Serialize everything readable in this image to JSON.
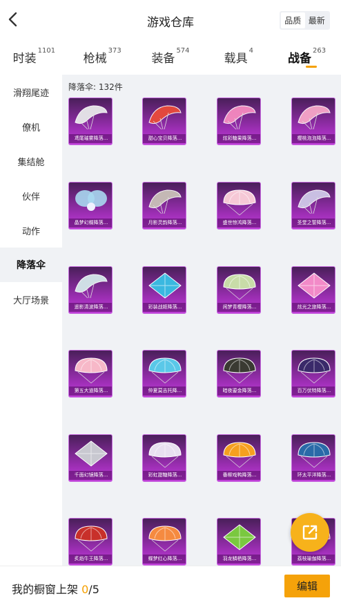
{
  "header": {
    "title": "游戏仓库",
    "sort_options": [
      "品质",
      "最新"
    ]
  },
  "tabs": [
    {
      "label": "时装",
      "count": "1101"
    },
    {
      "label": "枪械",
      "count": "373"
    },
    {
      "label": "装备",
      "count": "574"
    },
    {
      "label": "载具",
      "count": "4"
    },
    {
      "label": "战备",
      "count": "263"
    }
  ],
  "sidebar": {
    "items": [
      "滑翔尾迹",
      "僚机",
      "集结舱",
      "伙伴",
      "动作",
      "降落伞",
      "大厅场景"
    ]
  },
  "content": {
    "count_label": "降落伞: 132件",
    "items": [
      {
        "name": "鸢尾璀雾降落...",
        "color": "#e8e8ea",
        "shape": "wing"
      },
      {
        "name": "甜心宝贝降落...",
        "color": "#e94a3a",
        "shape": "wing"
      },
      {
        "name": "炫彩糖果降落...",
        "color": "#f58ac0",
        "shape": "wing"
      },
      {
        "name": "樱桃泡泡降落...",
        "color": "#f7a6c8",
        "shape": "wing"
      },
      {
        "name": "晶梦幻蝶降落...",
        "color": "#a8d8f0",
        "shape": "butterfly"
      },
      {
        "name": "月影灵韵降落...",
        "color": "#c9c0b8",
        "shape": "wing"
      },
      {
        "name": "盛世惊鸿降落...",
        "color": "#f6c8d6",
        "shape": "dome"
      },
      {
        "name": "圣堂之誓降落...",
        "color": "#cfc8e8",
        "shape": "wing"
      },
      {
        "name": "遥影清波降落...",
        "color": "#d4e8ea",
        "shape": "wing"
      },
      {
        "name": "彩装战姬降落...",
        "color": "#3ab8e0",
        "shape": "kite"
      },
      {
        "name": "闲梦青樱降落...",
        "color": "#c8dca8",
        "shape": "dome"
      },
      {
        "name": "炫光之旅降落...",
        "color": "#f28ac8",
        "shape": "kite"
      },
      {
        "name": "第五大道降落...",
        "color": "#f7b8c8",
        "shape": "dome"
      },
      {
        "name": "仲夏莫吉托降...",
        "color": "#5ac8e8",
        "shape": "dome"
      },
      {
        "name": "暗夜鎏金降落...",
        "color": "#3a3a32",
        "shape": "dome"
      },
      {
        "name": "百万伏特降落...",
        "color": "#3a2a6a",
        "shape": "dome"
      },
      {
        "name": "千面幻镜降落...",
        "color": "#c8c8d0",
        "shape": "kite"
      },
      {
        "name": "彩虹甜糖降落...",
        "color": "#e8e0f0",
        "shape": "dome"
      },
      {
        "name": "番柳戏鸭降落...",
        "color": "#f5a020",
        "shape": "dome"
      },
      {
        "name": "环太平洋降落...",
        "color": "#2a6aa8",
        "shape": "dome"
      },
      {
        "name": "炙焰牛王降落...",
        "color": "#c8302a",
        "shape": "dome"
      },
      {
        "name": "蝶梦红心降落...",
        "color": "#f58a40",
        "shape": "dome"
      },
      {
        "name": "羽龙鳞栖降落...",
        "color": "#7ac840",
        "shape": "kite"
      },
      {
        "name": "荔枝瑜伽降落...",
        "color": "#f06a90",
        "shape": "dome"
      }
    ]
  },
  "bottom": {
    "showcase_label": "我的橱窗上架",
    "showcase_current": "0",
    "showcase_total": "/5",
    "edit_label": "编辑"
  },
  "colors": {
    "accent": "#f5a000",
    "card_purple": "#a02fb8",
    "fab": "#f7b21b"
  },
  "icons": [
    "back-chevron-icon",
    "share-icon"
  ]
}
